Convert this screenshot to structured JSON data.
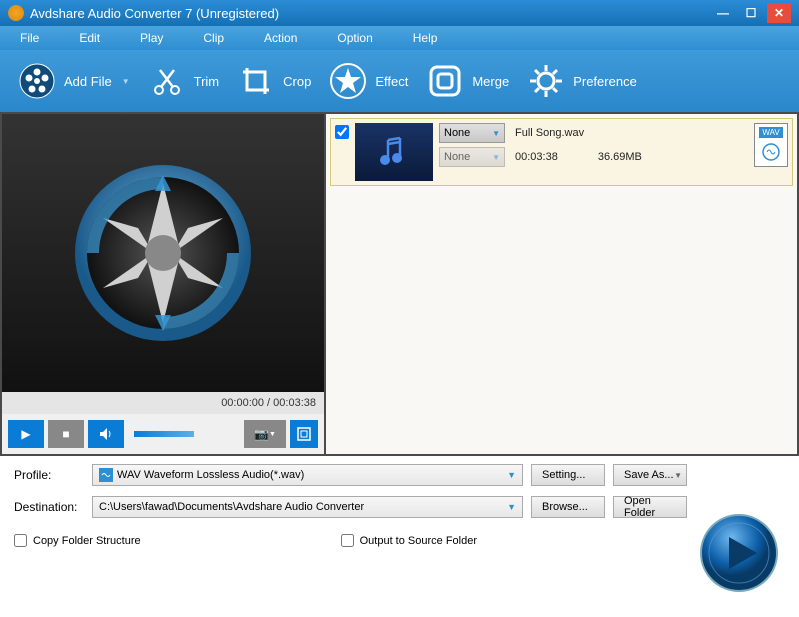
{
  "titlebar": {
    "title": "Avdshare Audio Converter 7 (Unregistered)"
  },
  "menu": {
    "file": "File",
    "edit": "Edit",
    "play": "Play",
    "clip": "Clip",
    "action": "Action",
    "option": "Option",
    "help": "Help"
  },
  "toolbar": {
    "add_file": "Add File",
    "trim": "Trim",
    "crop": "Crop",
    "effect": "Effect",
    "merge": "Merge",
    "preference": "Preference"
  },
  "preview": {
    "current_time": "00:00:00",
    "total_time": "00:03:38",
    "time_display": "00:00:00 / 00:03:38"
  },
  "filelist": {
    "items": [
      {
        "checked": true,
        "filename": "Full Song.wav",
        "duration": "00:03:38",
        "size": "36.69MB",
        "format_label": "WAV",
        "dropdown1": "None",
        "dropdown2": "None"
      }
    ]
  },
  "bottom": {
    "profile_label": "Profile:",
    "profile_value": "WAV Waveform Lossless Audio(*.wav)",
    "destination_label": "Destination:",
    "destination_value": "C:\\Users\\fawad\\Documents\\Avdshare Audio Converter",
    "setting_btn": "Setting...",
    "save_as_btn": "Save As...",
    "browse_btn": "Browse...",
    "open_folder_btn": "Open Folder",
    "copy_folder": "Copy Folder Structure",
    "output_source": "Output to Source Folder"
  }
}
